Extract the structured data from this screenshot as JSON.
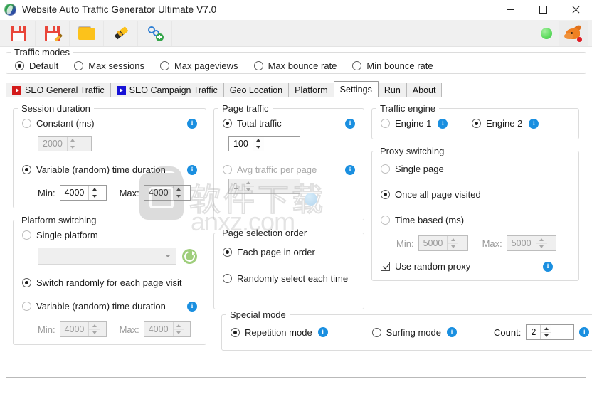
{
  "window": {
    "title": "Website Auto Traffic Generator Ultimate V7.0",
    "app_icon": "globe-icon",
    "minimize": "minimize-icon",
    "maximize": "maximize-icon",
    "close": "close-icon"
  },
  "toolbar": {
    "buttons": [
      {
        "name": "save-icon",
        "tooltip": "Save"
      },
      {
        "name": "save-as-icon",
        "tooltip": "Save as"
      },
      {
        "name": "open-folder-icon",
        "tooltip": "Open"
      },
      {
        "name": "flashlight-icon",
        "tooltip": "Test"
      },
      {
        "name": "add-link-icon",
        "tooltip": "Add link"
      }
    ],
    "status_indicator": "green-status-dot",
    "right_icon": "dragon-icon"
  },
  "traffic_modes": {
    "legend": "Traffic modes",
    "options": [
      {
        "label": "Default",
        "selected": true
      },
      {
        "label": "Max sessions",
        "selected": false
      },
      {
        "label": "Max pageviews",
        "selected": false
      },
      {
        "label": "Max bounce rate",
        "selected": false
      },
      {
        "label": "Min bounce rate",
        "selected": false
      }
    ]
  },
  "tabs": [
    {
      "label": "SEO General Traffic",
      "icon": "play-red-icon",
      "active": false
    },
    {
      "label": "SEO Campaign Traffic",
      "icon": "play-blue-icon",
      "active": false
    },
    {
      "label": "Geo Location",
      "icon": "",
      "active": false
    },
    {
      "label": "Platform",
      "icon": "",
      "active": false
    },
    {
      "label": "Settings",
      "icon": "",
      "active": true
    },
    {
      "label": "Run",
      "icon": "",
      "active": false
    },
    {
      "label": "About",
      "icon": "",
      "active": false
    }
  ],
  "session_duration": {
    "legend": "Session duration",
    "constant": {
      "label": "Constant (ms)",
      "selected": false,
      "value": "2000",
      "disabled": true,
      "info": "info-icon"
    },
    "variable": {
      "label": "Variable (random) time duration",
      "selected": true,
      "info": "info-icon"
    },
    "min_label": "Min:",
    "min_value": "4000",
    "max_label": "Max:",
    "max_value": "4000"
  },
  "platform_switching": {
    "legend": "Platform switching",
    "single": {
      "label": "Single platform",
      "selected": false
    },
    "combo_value": "",
    "refresh": "refresh-icon",
    "switch_random": {
      "label": "Switch randomly for each page visit",
      "selected": true
    },
    "variable": {
      "label": "Variable (random) time duration",
      "selected": false,
      "info": "info-icon"
    },
    "min_label": "Min:",
    "min_value": "4000",
    "max_label": "Max:",
    "max_value": "4000"
  },
  "page_traffic": {
    "legend": "Page traffic",
    "total": {
      "label": "Total traffic",
      "selected": true,
      "value": "100",
      "info": "info-icon"
    },
    "avg": {
      "label": "Avg traffic per page",
      "selected": false,
      "value": "1",
      "disabled": true,
      "info": "info-icon"
    }
  },
  "page_selection_order": {
    "legend": "Page selection order",
    "options": [
      {
        "label": "Each page in order",
        "selected": true
      },
      {
        "label": "Randomly select each time",
        "selected": false
      }
    ]
  },
  "traffic_engine": {
    "legend": "Traffic engine",
    "options": [
      {
        "label": "Engine 1",
        "selected": false,
        "info": "info-icon"
      },
      {
        "label": "Engine 2",
        "selected": true,
        "info": "info-icon"
      }
    ]
  },
  "proxy_switching": {
    "legend": "Proxy switching",
    "single_page": {
      "label": "Single page",
      "selected": false
    },
    "once_all": {
      "label": "Once all page visited",
      "selected": true
    },
    "time_based": {
      "label": "Time based (ms)",
      "selected": false
    },
    "min_label": "Min:",
    "min_value": "5000",
    "max_label": "Max:",
    "max_value": "5000",
    "use_random_proxy": {
      "label": "Use random proxy",
      "checked": true,
      "info": "info-icon"
    }
  },
  "special_mode": {
    "legend": "Special mode",
    "repetition": {
      "label": "Repetition mode",
      "selected": true,
      "info": "info-icon"
    },
    "surfing": {
      "label": "Surfing mode",
      "selected": false,
      "info": "info-icon"
    },
    "count_label": "Count:",
    "count_value": "2",
    "count_info": "info-icon"
  },
  "watermark": {
    "chinese": "软件下载",
    "domain": "anxz.com"
  },
  "colors": {
    "accent_info": "#1a8fe0",
    "tab_red": "#d31b1b",
    "tab_blue": "#1712d6",
    "special_legend": "#34c759",
    "status_green": "#5ddb5d"
  }
}
